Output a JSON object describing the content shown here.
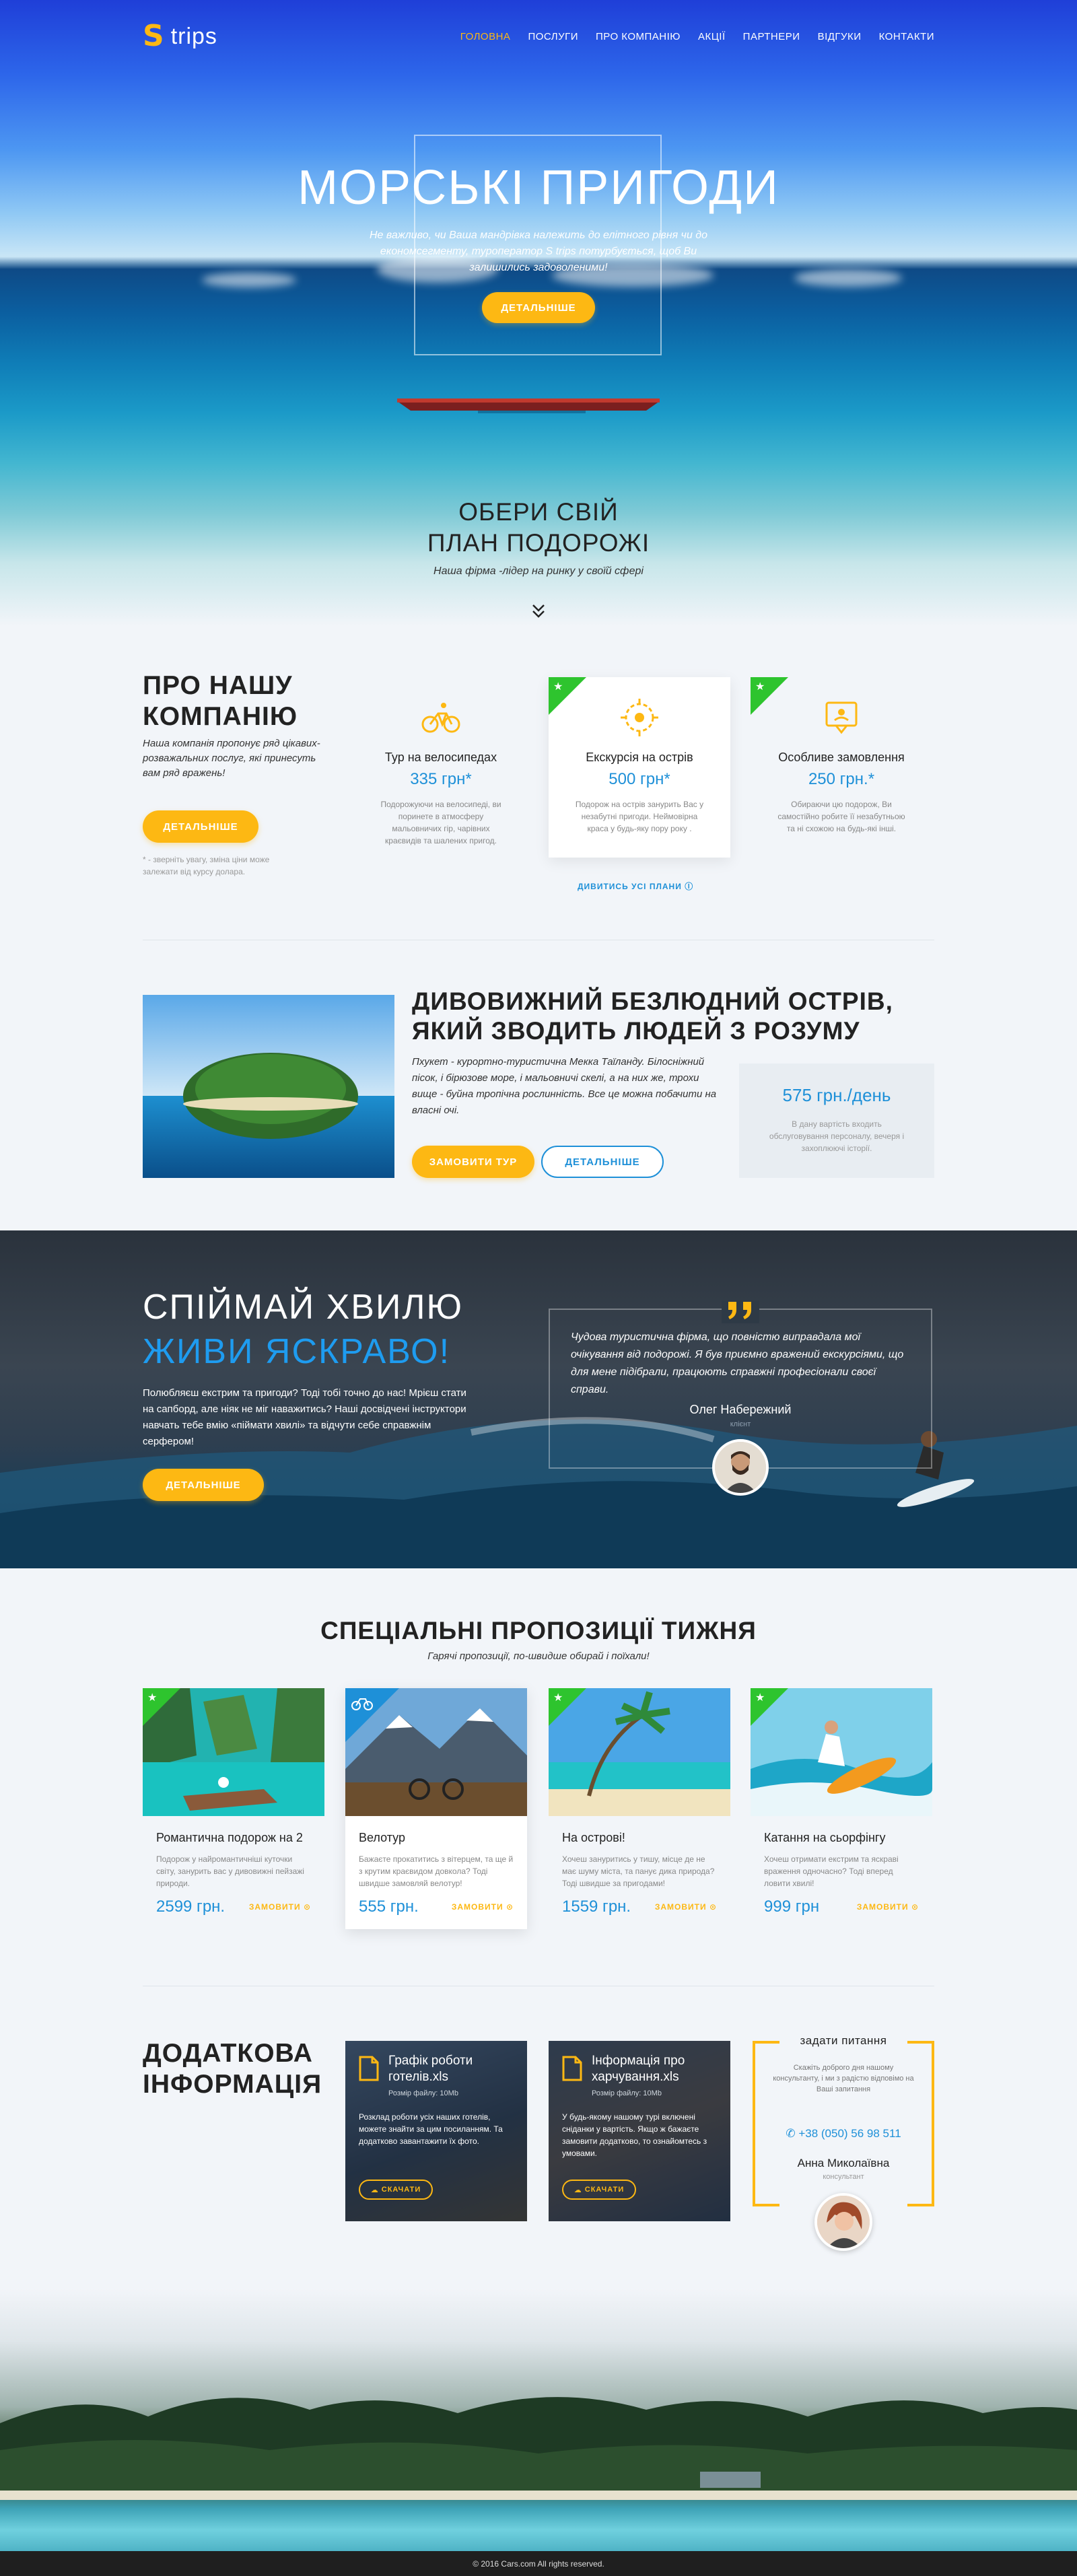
{
  "brand": {
    "logo_mark": "S",
    "logo_text": "trips"
  },
  "nav": {
    "items": [
      {
        "label": "ГОЛОВНА",
        "active": true
      },
      {
        "label": "ПОСЛУГИ"
      },
      {
        "label": "ПРО КОМПАНІЮ"
      },
      {
        "label": "АКЦІЇ"
      },
      {
        "label": "ПАРТНЕРИ"
      },
      {
        "label": "ВІДГУКИ"
      },
      {
        "label": "КОНТАКТИ"
      }
    ]
  },
  "hero": {
    "title": "МОРСЬКІ ПРИГОДИ",
    "subtitle": "Не важливо, чи Ваша мандрівка належить до елітного рівня чи до економсегменту, туроператор S trips потурбується, щоб Ви залишились задоволеними!",
    "button": "ДЕТАЛЬНІШЕ",
    "plan_title_1": "ОБЕРИ СВІЙ",
    "plan_title_2": "ПЛАН ПОДОРОЖІ",
    "plan_subtitle": "Наша фірма -лідер на ринку у своїй сфері"
  },
  "about": {
    "title_1": "ПРО НАШУ",
    "title_2": "КОМПАНІЮ",
    "text": "Наша компанія пропонує ряд цікавих-розважальних послуг, які принесуть вам ряд вражень!",
    "button": "ДЕТАЛЬНІШЕ",
    "note": "* - зверніть увагу, змінa ціни може залежати від курсу долара.",
    "services": [
      {
        "icon": "bicycle-icon",
        "title": "Тур на велосипедах",
        "price": "335 грн*",
        "desc": "Подорожуючи на велосипеді, ви поринете в атмосферу мальовничих гір, чарівних краєвидів та шалених пригод.",
        "featured": false
      },
      {
        "icon": "target-icon",
        "title": "Екскурсія на острів",
        "price": "500 грн*",
        "desc": "Подорож на острів занурить Вас у незабутні пригоди. Неймовірна краса у будь-яку пору року .",
        "featured": true
      },
      {
        "icon": "chat-icon",
        "title": "Особливе замовлення",
        "price": "250 грн.*",
        "desc": "Обираючи цю подорож, Ви самостійно робите її незабутньою та ні схожою на будь-які інші.",
        "featured": false
      }
    ],
    "all_plans": "ДИВИТИСЬ УСІ ПЛАНИ"
  },
  "island": {
    "title": "ДИВОВИЖНИЙ БЕЗЛЮДНИЙ ОСТРІВ, ЯКИЙ ЗВОДИТЬ ЛЮДЕЙ З РОЗУМУ",
    "text": "Пхукет - курортно-туристична Мекка Таїланду. Білосніжний пісок, і бірюзове море, і мальовничі скелі, а на них же, трохи вище - буйна тропічна рослинність. Все це можна побачити на власні очі.",
    "btn_order": "ЗАМОВИТИ ТУР",
    "btn_more": "ДЕТАЛЬНІШЕ",
    "price": "575 грн./день",
    "price_desc": "В дану вартість входить обслуговування персоналу, вечеря і захоплюючі історії."
  },
  "wave": {
    "title_1": "СПІЙМАЙ ХВИЛЮ",
    "title_2": "ЖИВИ ЯСКРАВО!",
    "text": "Полюбляєш екстрим та пригоди? Тоді тобі точно до нас! Мрієш стати на сапборд, але ніяк не міг наважитись? Наші досвідчені інструктори навчать тебе вмію «піймати хвилі» та відчути себе справжнім серфером!",
    "button": "ДЕТАЛЬНІШЕ",
    "quote": "Чудова туристична фірма, що повністю виправдала мої очікування від подорожі. Я був приємно вражений екскурсіями, що для мене підібрали, працюють справжні професіонали своєї справи.",
    "author": "Олег Набережний",
    "author_role": "клієнт"
  },
  "specials": {
    "title": "СПЕЦІАЛЬНІ ПРОПОЗИЦІЇ ТИЖНЯ",
    "subtitle": "Гарячі пропозиції, по-швидше обирай і поїхали!",
    "order_label": "ЗАМОВИТИ",
    "cards": [
      {
        "title": "Романтична подорож на 2",
        "desc": "Подорож у найромантичніші куточки світу, занурить вас у дивовижні пейзажі природи.",
        "price": "2599 грн."
      },
      {
        "title": "Велотур",
        "desc": "Бажаєте прокатитись з вітерцем, та ще й з крутим краєвидом довкола? Тоді швидше замовляй велотур!",
        "price": "555 грн."
      },
      {
        "title": "На острові!",
        "desc": "Хочеш зануритись у тишу, місце де не має шуму міста, та панує дика природа? Тоді швидше за пригодами!",
        "price": "1559 грн."
      },
      {
        "title": "Катання на сьорфінгу",
        "desc": "Хочеш отримати екстрим та яскраві враження одночасно? Тоді вперед ловити хвилі!",
        "price": "999 грн"
      }
    ]
  },
  "additional": {
    "title_1": "ДОДАТКОВА",
    "title_2": "ІНФОРМАЦІЯ",
    "docs": [
      {
        "name": "Графік роботи готелів.xls",
        "size": "Розмір файлу: 10Mb",
        "desc": "Розклад роботи усіх наших готелів, можете знайти за цим посиланням. Та додатково завантажити їх фото.",
        "download": "СКАЧАТИ"
      },
      {
        "name": "Інформація про харчування.xls",
        "size": "Розмір файлу: 10Mb",
        "desc": "У будь-якому нашому турі включені сніданки у вартість. Якщо ж бажаєте замовити додатково, то ознайомтесь з умовами.",
        "download": "СКАЧАТИ"
      }
    ],
    "ask": {
      "title": "задати питання",
      "text": "Скажіть доброго дня нашому консультанту, і ми з радістю відповімо на Ваші запитання",
      "phone": "+38 (050) 56 98 511",
      "name": "Анна Миколаївна",
      "role": "консультант"
    }
  },
  "footer": {
    "copyright": "© 2016 Cars.com All rights reserved."
  },
  "colors": {
    "accent": "#fdb813",
    "blue": "#1e90d8",
    "green": "#2ec42e"
  }
}
